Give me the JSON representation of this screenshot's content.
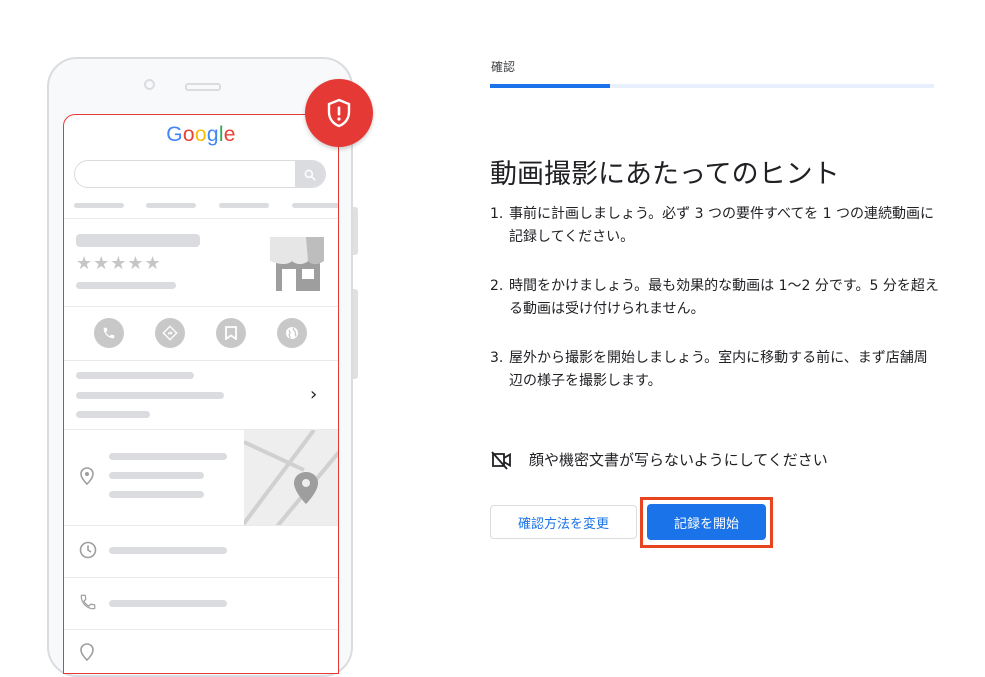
{
  "illustration": {
    "logo": [
      "G",
      "o",
      "o",
      "g",
      "l",
      "e"
    ],
    "stars": "★★★★★"
  },
  "header": {
    "step_label": "確認",
    "progress_percent": 27
  },
  "main": {
    "title": "動画撮影にあたってのヒント",
    "tips": [
      {
        "num": "1.",
        "text": "事前に計画しましょう。必ず 3 つの要件すべてを 1 つの連続動画に記録してください。"
      },
      {
        "num": "2.",
        "text": "時間をかけましょう。最も効果的な動画は 1〜2 分です。5 分を超える動画は受け付けられません。"
      },
      {
        "num": "3.",
        "text": "屋外から撮影を開始しましょう。室内に移動する前に、まず店舗周辺の様子を撮影します。"
      }
    ],
    "warning": {
      "icon": "videocam-off-icon",
      "text": "顔や機密文書が写らないようにしてください"
    }
  },
  "buttons": {
    "change_method": "確認方法を変更",
    "start_recording": "記録を開始"
  },
  "colors": {
    "accent": "#1a73e8",
    "badge": "#e53935",
    "highlight": "#e8441f"
  }
}
